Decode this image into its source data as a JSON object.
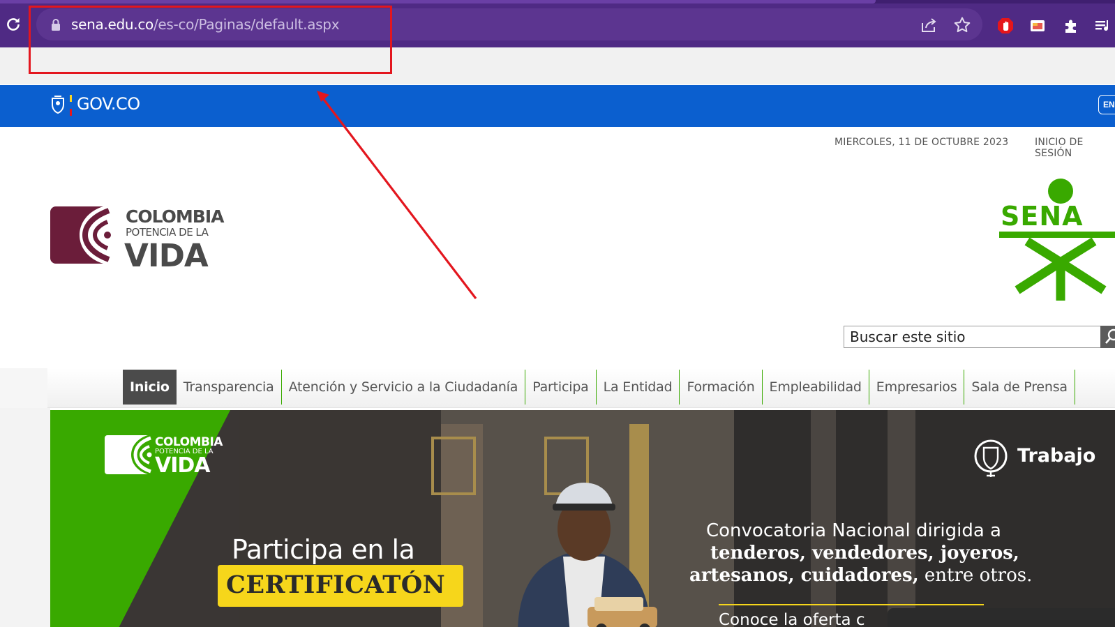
{
  "browser": {
    "url_host": "sena.edu.co",
    "url_path": "/es-co/Paginas/default.aspx",
    "icons": [
      "reload-icon",
      "lock-icon",
      "share-icon",
      "star-icon",
      "adblock-extension-icon",
      "cast-extension-icon",
      "puzzle-extension-icon",
      "media-queue-icon"
    ]
  },
  "gov_bar": {
    "brand": "GOV.CO",
    "lang_button": "EN"
  },
  "header": {
    "date": "MIERCOLES, 11 DE OCTUBRE 2023",
    "login": "INICIO DE SESIÓN",
    "logo_line1": "COLOMBIA",
    "logo_line2": "POTENCIA DE LA",
    "logo_line3": "VIDA",
    "sena_logo_text": "SENA",
    "search_placeholder": "Buscar este sitio"
  },
  "nav": {
    "items": [
      {
        "label": "Inicio",
        "active": true
      },
      {
        "label": "Transparencia"
      },
      {
        "label": "Atención y Servicio a la Ciudadanía"
      },
      {
        "label": "Participa"
      },
      {
        "label": "La Entidad"
      },
      {
        "label": "Formación"
      },
      {
        "label": "Empleabilidad"
      },
      {
        "label": "Empresarios"
      },
      {
        "label": "Sala de Prensa"
      }
    ]
  },
  "banner": {
    "logo_line1": "COLOMBIA",
    "logo_line2": "POTENCIA DE LA",
    "logo_line3": "VIDA",
    "ministry": "Trabajo",
    "title": "Participa en la",
    "badge": "CERTIFICATÓN",
    "conv_line1": "Convocatoria Nacional dirigida a",
    "conv_line2": "tenderos, vendedores, joyeros,",
    "conv_line3_bold": "artesanos, cuidadores,",
    "conv_line3_rest": " entre otros.",
    "conv_line4": "Conoce la oferta c"
  },
  "colors": {
    "browser_purple": "#4f2a84",
    "gov_blue": "#0b5fcf",
    "sena_green": "#39a900",
    "annotation_red": "#e3161e",
    "badge_yellow": "#f6d61b"
  }
}
